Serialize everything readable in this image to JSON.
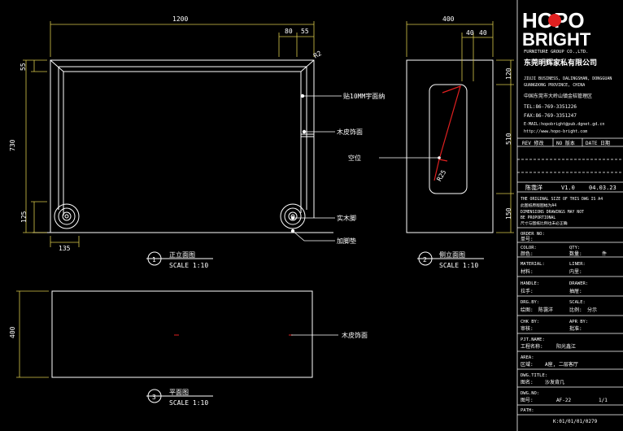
{
  "colors": {
    "background": "#000000",
    "lines": "#ffffff",
    "dimensions": "#d8c84a",
    "accent": "#e02020",
    "pink": "#e040e0"
  },
  "front": {
    "width": "1200",
    "top_dims": [
      "80",
      "55"
    ],
    "height": "730",
    "top_small": "55",
    "bottom_small": "125",
    "bottom_width": "135",
    "radius": "R2",
    "callouts": [
      "贴10MM宇面纳",
      "木皮饰面",
      "实木脚",
      "加脚垫"
    ],
    "number": "1",
    "title": "正立面图",
    "scale": "SCALE 1:10"
  },
  "side": {
    "width": "400",
    "top_dims": [
      "40",
      "40"
    ],
    "right_dims": [
      "120",
      "510",
      "150"
    ],
    "radius": "R25",
    "callout": "空位",
    "number": "2",
    "title": "侧立面图",
    "scale": "SCALE 1:10"
  },
  "plan": {
    "depth": "400",
    "callout": "木皮饰面",
    "number": "3",
    "title": "平面图",
    "scale": "SCALE 1:10"
  },
  "titleblock": {
    "logo_top": "HOPO",
    "logo_bottom": "BRIGHT",
    "company_en": "FURNITURE GROUP CO.,LTD.",
    "company_cn": "东莞明辉家私有限公司",
    "address": [
      "JIUJI BUSINESS, DALINGSHAN, DONGGUAN",
      "GUANGDONG PROVINCE, CHINA"
    ],
    "address_cn": "中国东莞市大岭山镇金桔管理区",
    "tel": "TEL:86-769-3351226",
    "fax": "FAX:86-769-3351247",
    "email": "E-MAIL:hopobright@pub.dgnet.gd.cn",
    "web": "http://www.hopo-bright.com",
    "rev_headers": [
      "REV 修改",
      "NO 版本",
      "DATE 日期"
    ],
    "rev_row": [
      "陈霭洋",
      "V1.0",
      "04.03.23"
    ],
    "notice": [
      "THE ORIGINAL SIZE OF THIS DWG IS A4",
      "此图纸原版图幅为A4",
      "DIMENSIONS DRAWINGS MAY NOT",
      "BE PROPORTIONAL",
      "尺寸与图纸比例也未必正确"
    ],
    "fields": [
      {
        "en": "ORDER NO:",
        "cn": "单号:",
        "val": ""
      },
      {
        "en": "COLOR:",
        "en2": "QTY:",
        "cn": "颜色:",
        "cn2": "数量:",
        "val2": "件"
      },
      {
        "en": "MATERIAL:",
        "en2": "LINER:",
        "cn": "材料:",
        "cn2": "内里:"
      },
      {
        "en": "HANDLE:",
        "en2": "DRAWER:",
        "cn": "拉手:",
        "cn2": "抽屉:"
      },
      {
        "en": "DRG.BY:",
        "en2": "SCALE:",
        "cn": "绘图:",
        "cn2": "比例:",
        "val": "陈霭洋",
        "val2": "分示"
      },
      {
        "en": "CHK BY:",
        "en2": "APR BY:",
        "cn": "审核:",
        "cn2": "批准:"
      },
      {
        "en": "PJT.NAME:",
        "cn": "工程名称:",
        "val": "阳光鑫江"
      },
      {
        "en": "AREA:",
        "cn": "区域:",
        "val": "A座, 二层客厅"
      },
      {
        "en": "DWG.TITLE:",
        "cn": "图名:",
        "val": "沙发背几"
      },
      {
        "en": "DWG.NO:",
        "cn": "图号:",
        "val": "AF-22",
        "val2": "1/1"
      },
      {
        "en": "PATH:",
        "cn": "",
        "val": "K:01/01/01/0279"
      }
    ]
  }
}
